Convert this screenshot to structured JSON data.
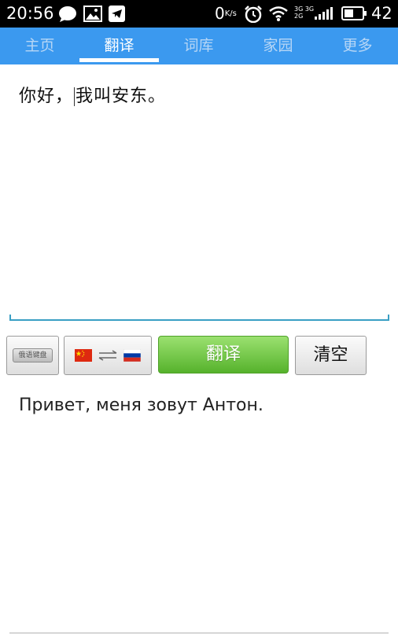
{
  "status_bar": {
    "time": "20:56",
    "speed_value": "0",
    "speed_unit": "K/s",
    "network_top": "3G 3G",
    "network_bottom": "2G",
    "battery_level": "42",
    "icons": [
      "chat-bubble-icon",
      "image-icon",
      "telegram-icon",
      "alarm-icon",
      "wifi-icon",
      "signal-icon",
      "battery-icon"
    ]
  },
  "tabs": [
    {
      "label": "主页",
      "active": false
    },
    {
      "label": "翻译",
      "active": true
    },
    {
      "label": "词库",
      "active": false
    },
    {
      "label": "家园",
      "active": false
    },
    {
      "label": "更多",
      "active": false
    }
  ],
  "input": {
    "before_cursor": "你好，",
    "after_cursor": "我叫安东。"
  },
  "controls": {
    "keyboard_label": "俄语键盘",
    "translate_label": "翻译",
    "clear_label": "清空"
  },
  "output": {
    "text": "Привет, меня зовут Антон."
  },
  "colors": {
    "tab_bar": "#3b99ef",
    "translate_button": "#6cc63c",
    "input_underline": "#3a9fc4"
  }
}
